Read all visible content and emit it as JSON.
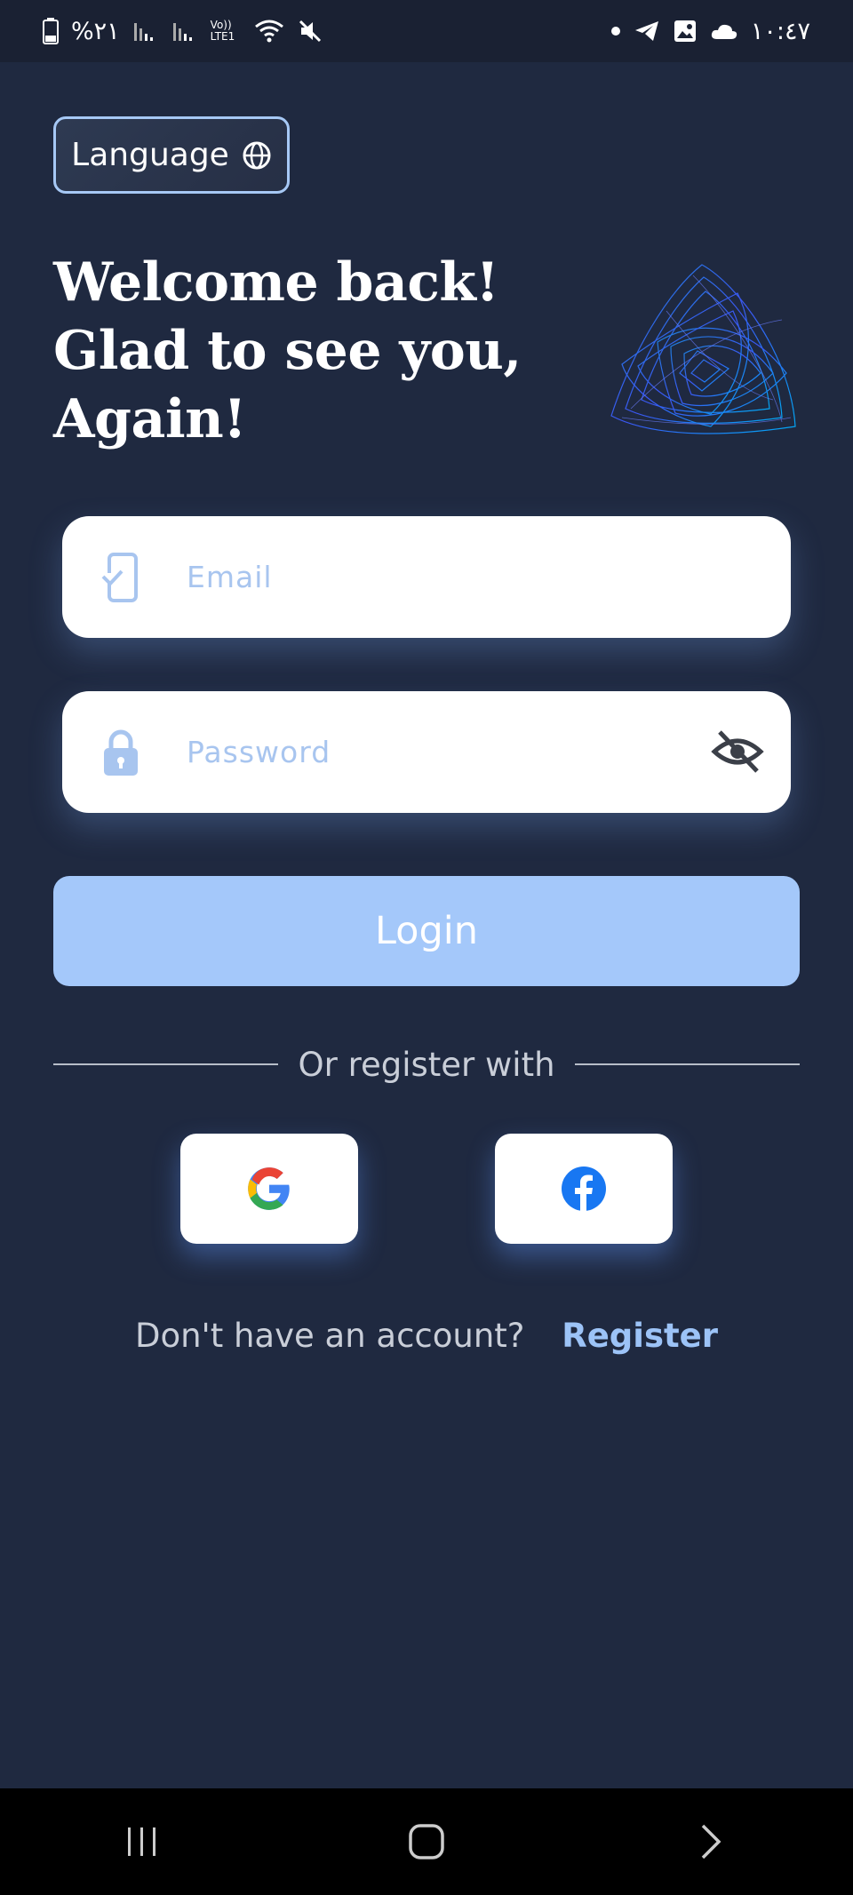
{
  "status_bar": {
    "battery_text": "%٢١",
    "time": "١٠:٤٧",
    "network_label": "Vo)) LTE1"
  },
  "language_button": {
    "label": "Language"
  },
  "welcome": {
    "text": "Welcome back!\nGlad to see you,\nAgain!"
  },
  "email_field": {
    "placeholder": "Email",
    "value": ""
  },
  "password_field": {
    "placeholder": "Password",
    "value": ""
  },
  "login_button": {
    "label": "Login"
  },
  "divider": {
    "text": "Or register with"
  },
  "social": {
    "google_icon": "google-icon",
    "facebook_icon": "facebook-icon"
  },
  "register_prompt": {
    "question": "Don't have an account?",
    "link": "Register"
  },
  "colors": {
    "background": "#1f2940",
    "accent": "#a4c8fa",
    "link": "#9cc3f7",
    "field_icon": "#a8c5ef"
  }
}
